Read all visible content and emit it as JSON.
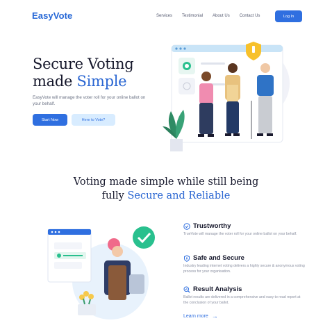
{
  "header": {
    "logo_text": "EasyVote",
    "nav": [
      "Services",
      "Testimonial",
      "About Us",
      "Contact Us"
    ],
    "login_label": "Log In"
  },
  "hero": {
    "title_line1": "Secure Voting",
    "title_line2_prefix": "made ",
    "title_line2_accent": "Simple",
    "subtitle": "EasyVote will manage the voter roll for your online ballot on your behalf.",
    "primary_button": "Start Now",
    "secondary_button": "Here to Vote?"
  },
  "section2": {
    "heading_line1": "Voting made simple while still being",
    "heading_line2_prefix": "fully ",
    "heading_line2_accent": "Secure and Reliable"
  },
  "features": [
    {
      "icon": "check-shield-icon",
      "title": "Trustworthy",
      "desc": "TrueVote will manage the voter roll for your online ballot on your behalf."
    },
    {
      "icon": "shield-icon",
      "title": "Safe and Secure",
      "desc": "Industry leading internet voting delivers a highly secure & anonymous voting process for your organisation."
    },
    {
      "icon": "search-chart-icon",
      "title": "Result Analysis",
      "desc": "Ballot results are delivered in a comprehensive and easy to read report at the conclusion of your ballot."
    }
  ],
  "learn_more": "Learn more",
  "colors": {
    "brand": "#2f6fe0",
    "accent_text": "#2a66d2",
    "light_button": "#d8ecff"
  }
}
